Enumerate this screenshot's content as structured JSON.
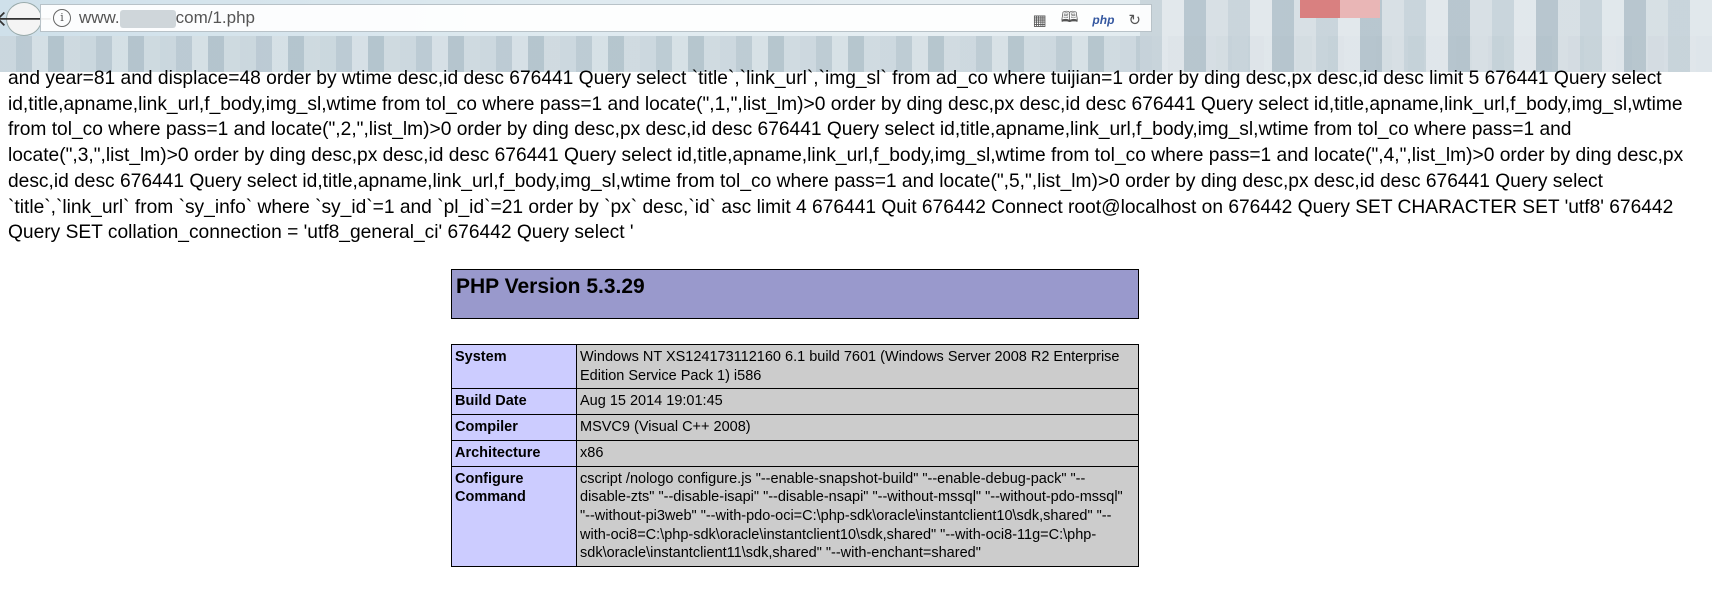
{
  "browser": {
    "url_prefix": "www.",
    "url_suffix": "com/1.php",
    "icons": [
      "qr-code-icon",
      "reader-mode-icon",
      "php-icon",
      "reload-icon"
    ],
    "php_icon_label": "php"
  },
  "log_text": "and year=81 and displace=48 order by wtime desc,id desc 676441 Query select `title`,`link_url`,`img_sl` from ad_co where tuijian=1 order by ding desc,px desc,id desc limit 5 676441 Query select id,title,apname,link_url,f_body,img_sl,wtime from tol_co where pass=1 and locate(\",1,\",list_lm)>0 order by ding desc,px desc,id desc 676441 Query select id,title,apname,link_url,f_body,img_sl,wtime from tol_co where pass=1 and locate(\",2,\",list_lm)>0 order by ding desc,px desc,id desc 676441 Query select id,title,apname,link_url,f_body,img_sl,wtime from tol_co where pass=1 and locate(\",3,\",list_lm)>0 order by ding desc,px desc,id desc 676441 Query select id,title,apname,link_url,f_body,img_sl,wtime from tol_co where pass=1 and locate(\",4,\",list_lm)>0 order by ding desc,px desc,id desc 676441 Query select id,title,apname,link_url,f_body,img_sl,wtime from tol_co where pass=1 and locate(\",5,\",list_lm)>0 order by ding desc,px desc,id desc 676441 Query select `title`,`link_url` from `sy_info` where `sy_id`=1 and `pl_id`=21 order by `px` desc,`id` asc limit 4 676441 Quit 676442 Connect root@localhost on 676442 Query SET CHARACTER SET 'utf8' 676442 Query SET collation_connection = 'utf8_general_ci' 676442 Query select '",
  "phpinfo": {
    "title": "PHP Version 5.3.29",
    "rows": [
      {
        "key": "System",
        "value": "Windows NT XS124173112160 6.1 build 7601 (Windows Server 2008 R2 Enterprise Edition Service Pack 1) i586"
      },
      {
        "key": "Build Date",
        "value": "Aug 15 2014 19:01:45"
      },
      {
        "key": "Compiler",
        "value": "MSVC9 (Visual C++ 2008)"
      },
      {
        "key": "Architecture",
        "value": "x86"
      },
      {
        "key": "Configure Command",
        "value": "cscript /nologo configure.js \"--enable-snapshot-build\" \"--enable-debug-pack\" \"--disable-zts\" \"--disable-isapi\" \"--disable-nsapi\" \"--without-mssql\" \"--without-pdo-mssql\" \"--without-pi3web\" \"--with-pdo-oci=C:\\php-sdk\\oracle\\instantclient10\\sdk,shared\" \"--with-oci8=C:\\php-sdk\\oracle\\instantclient10\\sdk,shared\" \"--with-oci8-11g=C:\\php-sdk\\oracle\\instantclient11\\sdk,shared\" \"--with-enchant=shared\""
      }
    ]
  }
}
